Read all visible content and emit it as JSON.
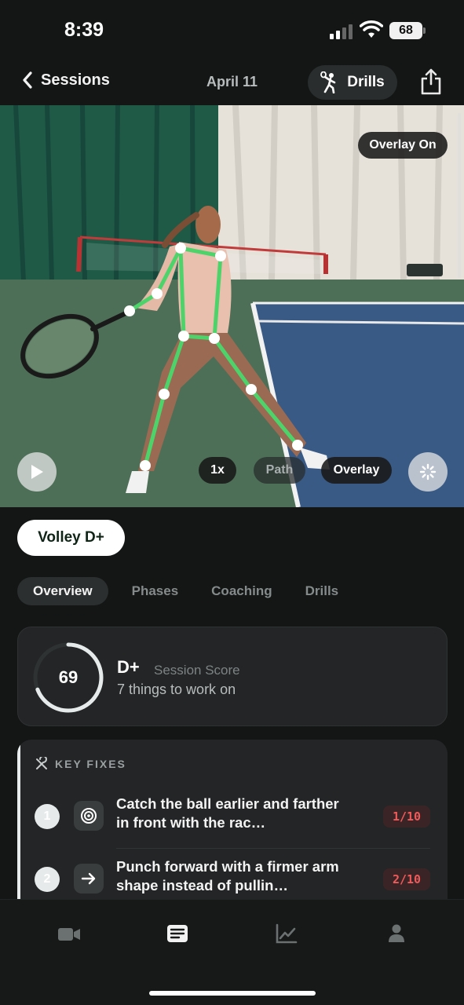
{
  "status": {
    "time": "8:39",
    "battery": "68"
  },
  "nav": {
    "back_label": "Sessions",
    "date": "April 11",
    "drills_label": "Drills"
  },
  "video": {
    "overlay_badge": "Overlay On",
    "speed": "1x",
    "path": "Path",
    "overlay": "Overlay"
  },
  "grade_badge": "Volley D+",
  "tabs": [
    {
      "label": "Overview",
      "active": true
    },
    {
      "label": "Phases",
      "active": false
    },
    {
      "label": "Coaching",
      "active": false
    },
    {
      "label": "Drills",
      "active": false
    }
  ],
  "score": {
    "value": "69",
    "value_fraction": 0.69,
    "grade": "D+",
    "label": "Session Score",
    "subtitle": "7 things to work on"
  },
  "key_fixes": {
    "header": "KEY FIXES",
    "items": [
      {
        "num": "1",
        "icon": "target-icon",
        "text": "Catch the ball earlier and farther in front with the rac…",
        "score": "1/10"
      },
      {
        "num": "2",
        "icon": "arrow-right-icon",
        "text": "Punch forward with a firmer arm shape instead of pullin…",
        "score": "2/10"
      }
    ]
  },
  "colors": {
    "accent_green": "#4cd36a",
    "score_red": "#ef5a5a",
    "background": "#141616"
  }
}
